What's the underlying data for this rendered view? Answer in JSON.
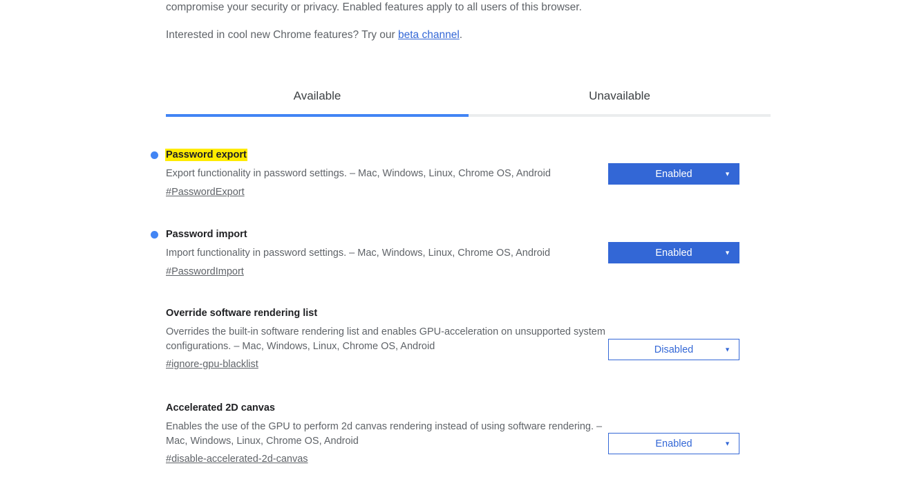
{
  "intro": {
    "line1": "compromise your security or privacy. Enabled features apply to all users of this browser.",
    "line2_prefix": "Interested in cool new Chrome features? Try our ",
    "line2_link": "beta channel",
    "line2_suffix": "."
  },
  "tabs": [
    {
      "label": "Available",
      "active": true
    },
    {
      "label": "Unavailable",
      "active": false
    }
  ],
  "colors": {
    "accent_blue": "#4285f4",
    "link_blue": "#3367d6",
    "highlight_yellow": "#ffeb00",
    "tab_track": "#ebedee",
    "text_primary": "#202124",
    "text_secondary": "#5f6368"
  },
  "flags": [
    {
      "title": "Password export",
      "highlighted": true,
      "has_dot": true,
      "description": "Export functionality in password settings. – Mac, Windows, Linux, Chrome OS, Android",
      "hash": "#PasswordExport",
      "select_value": "Enabled",
      "select_state": "modified",
      "arrow": "▼"
    },
    {
      "title": "Password import",
      "highlighted": false,
      "has_dot": true,
      "description": "Import functionality in password settings. – Mac, Windows, Linux, Chrome OS, Android",
      "hash": "#PasswordImport",
      "select_value": "Enabled",
      "select_state": "modified",
      "arrow": "▼"
    },
    {
      "title": "Override software rendering list",
      "highlighted": false,
      "has_dot": false,
      "description": "Overrides the built-in software rendering list and enables GPU-acceleration on unsupported system configurations. – Mac, Windows, Linux, Chrome OS, Android",
      "hash": "#ignore-gpu-blacklist",
      "select_value": "Disabled",
      "select_state": "default",
      "arrow": "▼"
    },
    {
      "title": "Accelerated 2D canvas",
      "highlighted": false,
      "has_dot": false,
      "description": "Enables the use of the GPU to perform 2d canvas rendering instead of using software rendering. – Mac, Windows, Linux, Chrome OS, Android",
      "hash": "#disable-accelerated-2d-canvas",
      "select_value": "Enabled",
      "select_state": "default",
      "arrow": "▼"
    }
  ]
}
